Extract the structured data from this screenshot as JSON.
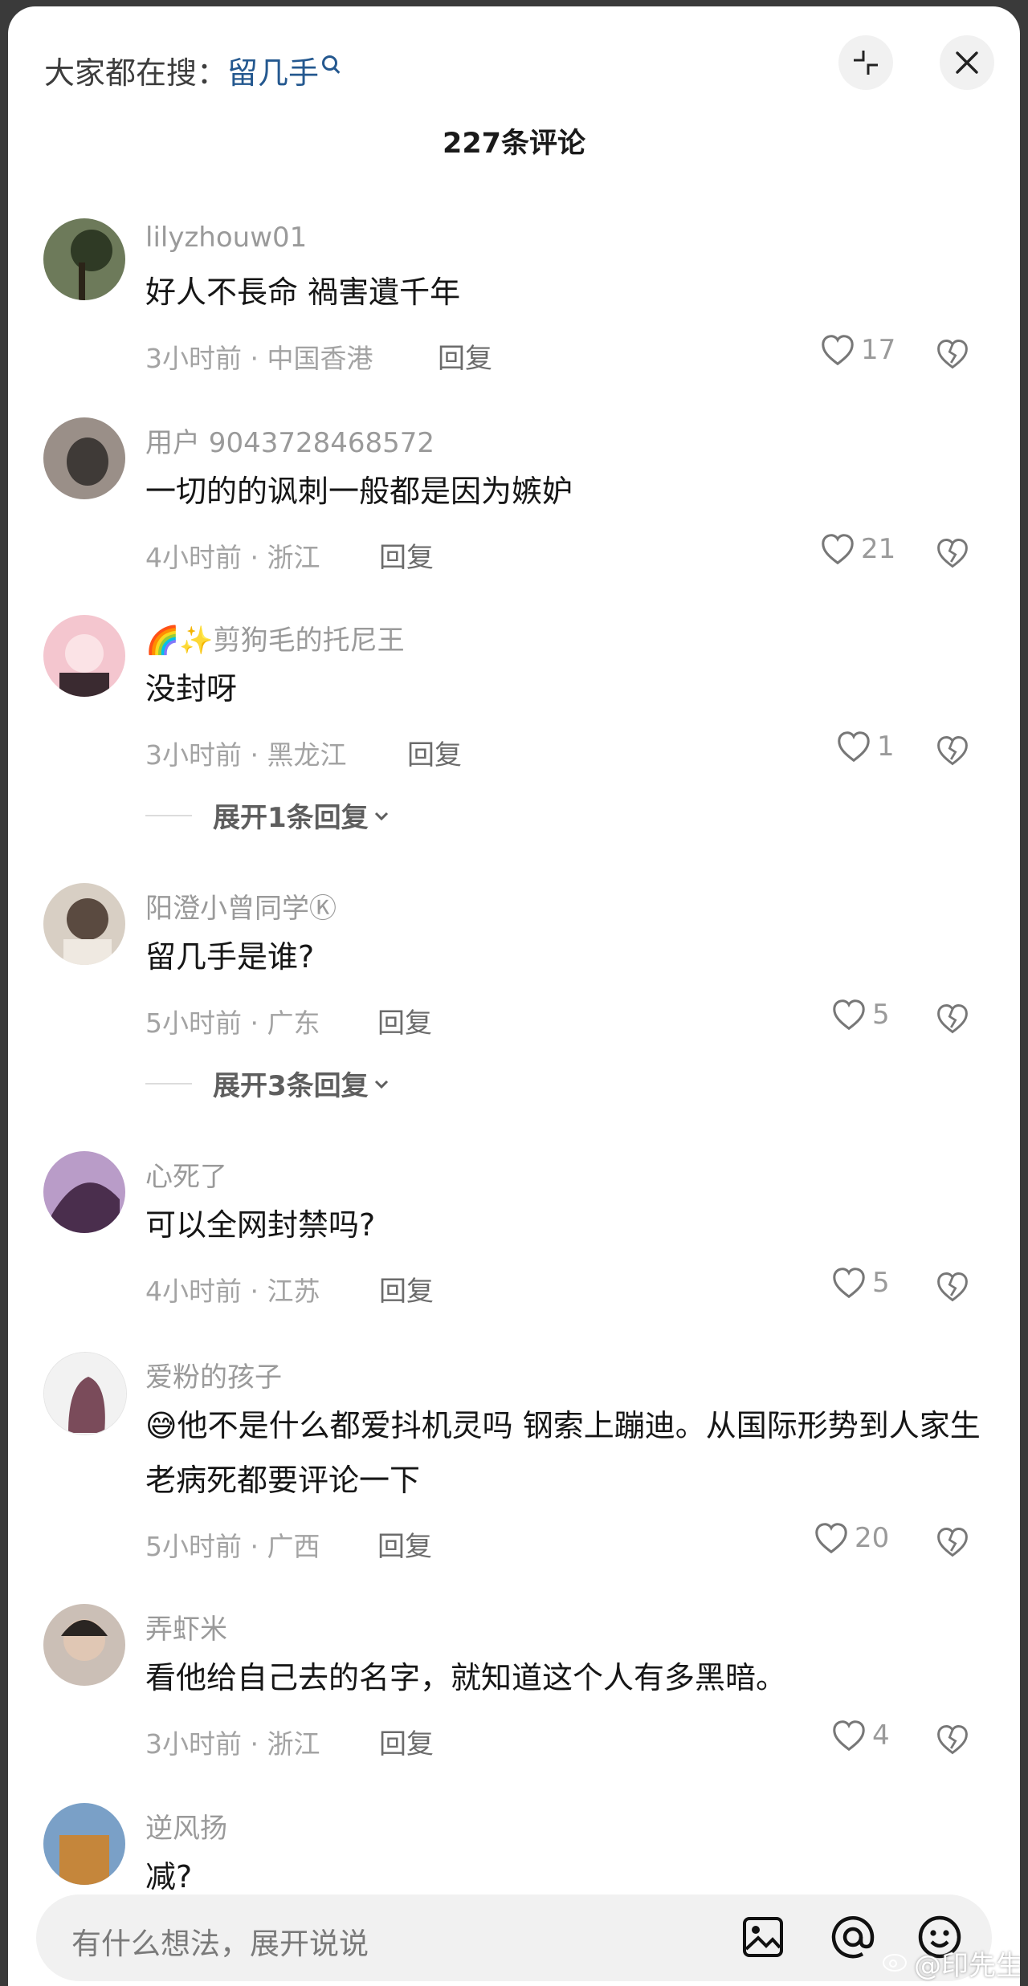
{
  "header": {
    "search_prefix": "大家都在搜：",
    "search_keyword": "留几手",
    "comment_count": "227条评论"
  },
  "comments": [
    {
      "user": "lilyzhouw01",
      "text": "好人不長命 禍害遺千年",
      "time": "3小时前 · 中国香港",
      "reply": "回复",
      "likes": "17",
      "avatar_colors": [
        "#6d7a5a",
        "#2f3a25"
      ]
    },
    {
      "user": "用户 9043728468572",
      "text": "一切的的讽刺一般都是因为嫉妒",
      "time": "4小时前 · 浙江",
      "reply": "回复",
      "likes": "21",
      "avatar_colors": [
        "#9a8f88",
        "#3f3a37"
      ]
    },
    {
      "user": "🌈✨剪狗毛的托尼王",
      "text": "没封呀",
      "time": "3小时前 · 黑龙江",
      "reply": "回复",
      "likes": "1",
      "expand": "展开1条回复",
      "avatar_colors": [
        "#f4c6cf",
        "#3a2a30"
      ]
    },
    {
      "user": "阳澄小曾同学Ⓚ",
      "text": "留几手是谁?",
      "time": "5小时前 · 广东",
      "reply": "回复",
      "likes": "5",
      "expand": "展开3条回复",
      "avatar_colors": [
        "#d8cfc4",
        "#5a4a40"
      ]
    },
    {
      "user": "心死了",
      "text": "可以全网封禁吗?",
      "time": "4小时前 · 江苏",
      "reply": "回复",
      "likes": "5",
      "avatar_colors": [
        "#b99cc8",
        "#4a2e4d"
      ]
    },
    {
      "user": "爱粉的孩子",
      "text": "😅他不是什么都爱抖机灵吗  钢索上蹦迪。从国际形势到人家生老病死都要评论一下",
      "time": "5小时前 · 广西",
      "reply": "回复",
      "likes": "20",
      "avatar_colors": [
        "#f2f2f2",
        "#7a4b5a"
      ]
    },
    {
      "user": "弄虾米",
      "text": "看他给自己去的名字，就知道这个人有多黑暗。",
      "time": "3小时前 · 浙江",
      "reply": "回复",
      "likes": "4",
      "avatar_colors": [
        "#cbbfb6",
        "#2a2522"
      ]
    },
    {
      "user": "逆风扬",
      "text": "减?",
      "time": "",
      "reply": "",
      "likes": "",
      "avatar_colors": [
        "#7aa0c7",
        "#c5863b"
      ]
    }
  ],
  "input": {
    "placeholder": "有什么想法，展开说说"
  },
  "icons": {
    "minimize": "minimize-icon",
    "close": "close-icon",
    "like": "heart-icon",
    "dislike": "broken-heart-icon",
    "image": "image-icon",
    "mention": "at-icon",
    "emoji": "emoji-icon",
    "search": "search-icon"
  },
  "watermark": "@印先生"
}
